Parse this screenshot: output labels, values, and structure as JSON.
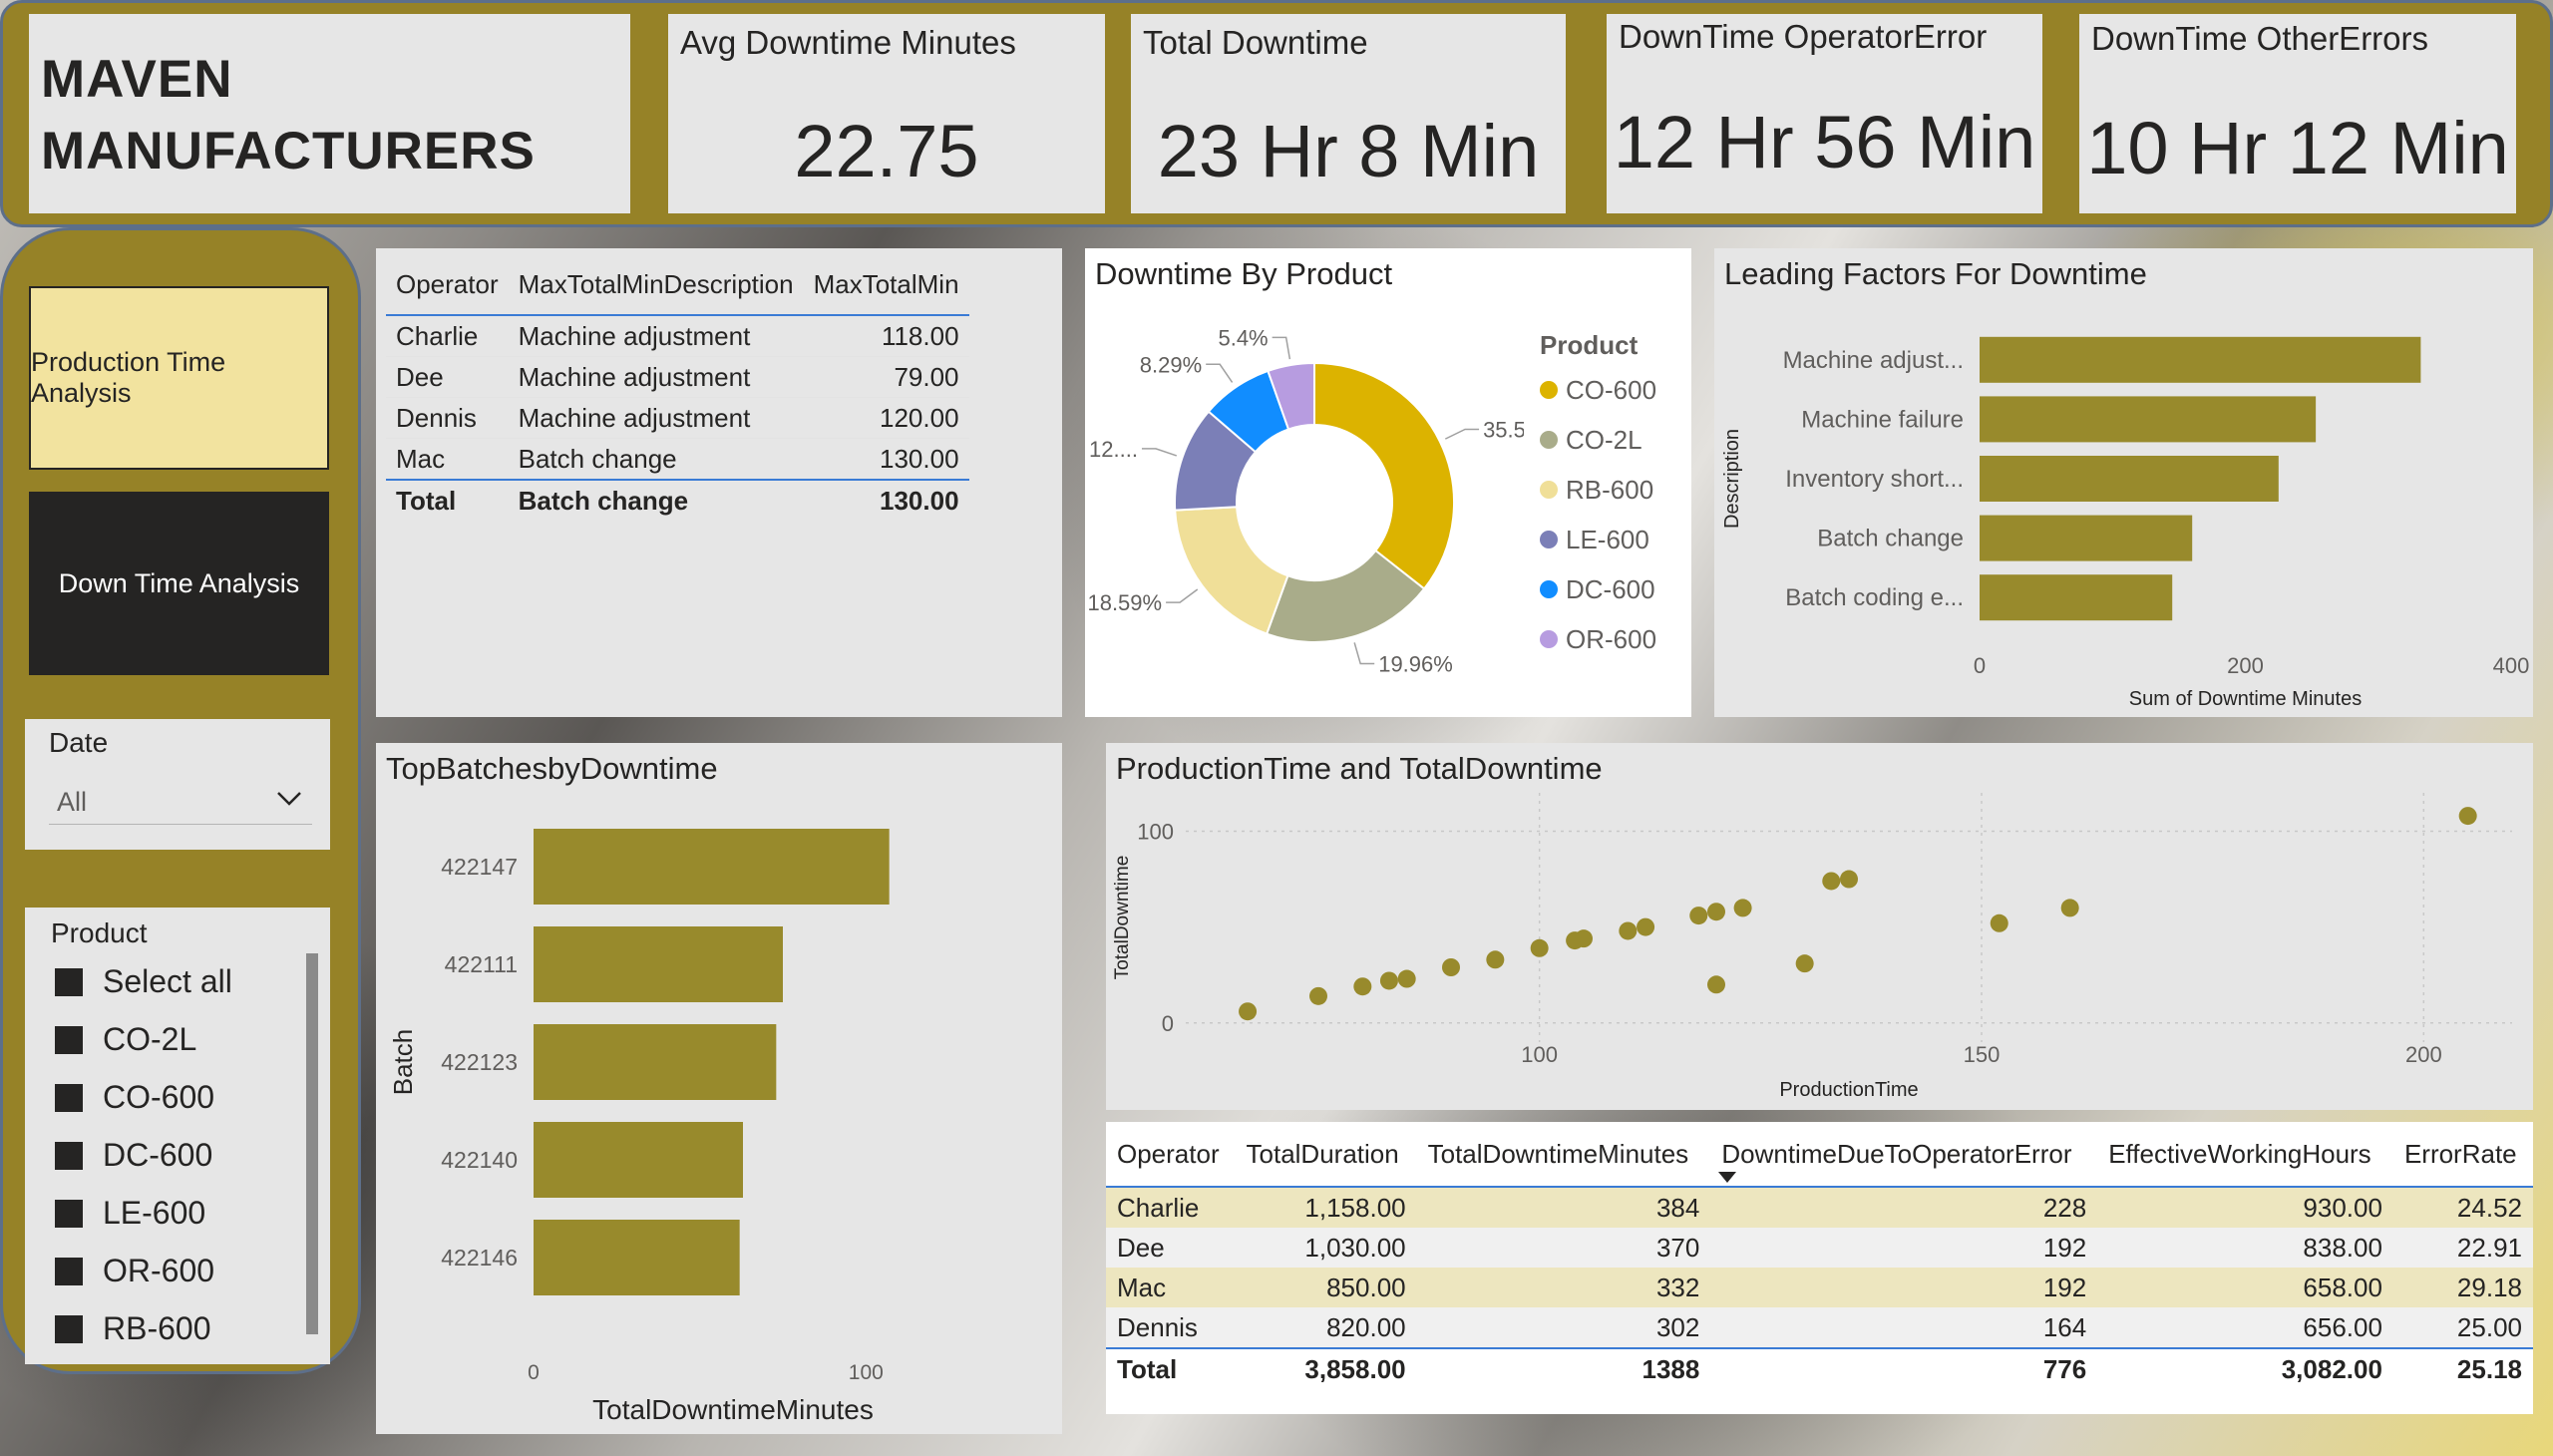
{
  "brand": {
    "line1": "MAVEN",
    "line2": "MANUFACTURERS"
  },
  "kpis": [
    {
      "title": "Avg Downtime Minutes",
      "value": "22.75"
    },
    {
      "title": "Total Downtime",
      "value": "23 Hr 8 Min"
    },
    {
      "title": "DownTime OperatorError",
      "value": "12 Hr 56 Min"
    },
    {
      "title": "DownTime OtherErrors",
      "value": "10 Hr 12 Min"
    }
  ],
  "nav": {
    "production_label": "Production Time Analysis",
    "downtime_label": "Down Time Analysis"
  },
  "date_slicer": {
    "title": "Date",
    "value": "All"
  },
  "product_slicer": {
    "title": "Product",
    "items": [
      "Select all",
      "CO-2L",
      "CO-600",
      "DC-600",
      "LE-600",
      "OR-600",
      "RB-600"
    ]
  },
  "operator_table": {
    "headers": [
      "Operator",
      "MaxTotalMinDescription",
      "MaxTotalMin"
    ],
    "rows": [
      [
        "Charlie",
        "Machine adjustment",
        "118.00"
      ],
      [
        "Dee",
        "Machine adjustment",
        "79.00"
      ],
      [
        "Dennis",
        "Machine adjustment",
        "120.00"
      ],
      [
        "Mac",
        "Batch change",
        "130.00"
      ]
    ],
    "total": [
      "Total",
      "Batch change",
      "130.00"
    ]
  },
  "colors": {
    "bar": "#988a2c",
    "scatter": "#988a2c",
    "panel": "#968227",
    "nav_active": "#f2e39f",
    "nav_dark": "#252423"
  },
  "chart_data": [
    {
      "type": "pie",
      "title": "Downtime By Product",
      "legend_title": "Product",
      "legend_position": "right",
      "slices": [
        {
          "name": "CO-600",
          "value": 35.59,
          "label": "35.59%",
          "color": "#dcb300"
        },
        {
          "name": "CO-2L",
          "value": 19.96,
          "label": "19.96%",
          "color": "#a9ac8a"
        },
        {
          "name": "RB-600",
          "value": 18.59,
          "label": "18.59%",
          "color": "#f0df98"
        },
        {
          "name": "LE-600",
          "value": 12.18,
          "label": "12....",
          "color": "#7b7fb7"
        },
        {
          "name": "DC-600",
          "value": 8.29,
          "label": "8.29%",
          "color": "#118dff"
        },
        {
          "name": "OR-600",
          "value": 5.4,
          "label": "5.4%",
          "color": "#b79ce0"
        }
      ]
    },
    {
      "type": "bar",
      "title": "Leading Factors For Downtime",
      "orientation": "horizontal",
      "categories": [
        "Machine adjust...",
        "Machine failure",
        "Inventory short...",
        "Batch change",
        "Batch coding e..."
      ],
      "values": [
        332,
        253,
        225,
        160,
        145
      ],
      "xlabel": "Sum of Downtime Minutes",
      "ylabel": "Description",
      "xlim": [
        0,
        400
      ],
      "xticks": [
        "0",
        "200",
        "400"
      ]
    },
    {
      "type": "bar",
      "title": "TopBatchesbyDowntime",
      "orientation": "horizontal",
      "categories": [
        "422147",
        "422111",
        "422123",
        "422140",
        "422146"
      ],
      "values": [
        107,
        75,
        73,
        63,
        62
      ],
      "xlabel": "TotalDowntimeMinutes",
      "ylabel": "Batch",
      "xlim": [
        0,
        120
      ],
      "xticks": [
        "0",
        "100"
      ]
    },
    {
      "type": "scatter",
      "title": "ProductionTime and TotalDowntime",
      "xlabel": "ProductionTime",
      "ylabel": "TotalDowntime",
      "xlim": [
        60,
        210
      ],
      "ylim": [
        -10,
        120
      ],
      "xticks": [
        "100",
        "150",
        "200"
      ],
      "yticks": [
        "0",
        "100"
      ],
      "points": [
        [
          67,
          6
        ],
        [
          75,
          14
        ],
        [
          80,
          19
        ],
        [
          83,
          22
        ],
        [
          85,
          23
        ],
        [
          90,
          29
        ],
        [
          95,
          33
        ],
        [
          100,
          39
        ],
        [
          104,
          43
        ],
        [
          105,
          44
        ],
        [
          110,
          48
        ],
        [
          112,
          50
        ],
        [
          118,
          56
        ],
        [
          120,
          58
        ],
        [
          120,
          20
        ],
        [
          123,
          60
        ],
        [
          130,
          31
        ],
        [
          133,
          74
        ],
        [
          135,
          75
        ],
        [
          152,
          52
        ],
        [
          160,
          60
        ],
        [
          205,
          108
        ]
      ]
    }
  ],
  "summary_table": {
    "headers": [
      "Operator",
      "TotalDuration",
      "TotalDowntimeMinutes",
      "DowntimeDueToOperatorError",
      "EffectiveWorkingHours",
      "ErrorRate"
    ],
    "rows": [
      [
        "Charlie",
        "1,158.00",
        "384",
        "228",
        "930.00",
        "24.52"
      ],
      [
        "Dee",
        "1,030.00",
        "370",
        "192",
        "838.00",
        "22.91"
      ],
      [
        "Mac",
        "850.00",
        "332",
        "192",
        "658.00",
        "29.18"
      ],
      [
        "Dennis",
        "820.00",
        "302",
        "164",
        "656.00",
        "25.00"
      ]
    ],
    "total": [
      "Total",
      "3,858.00",
      "1388",
      "776",
      "3,082.00",
      "25.18"
    ]
  }
}
